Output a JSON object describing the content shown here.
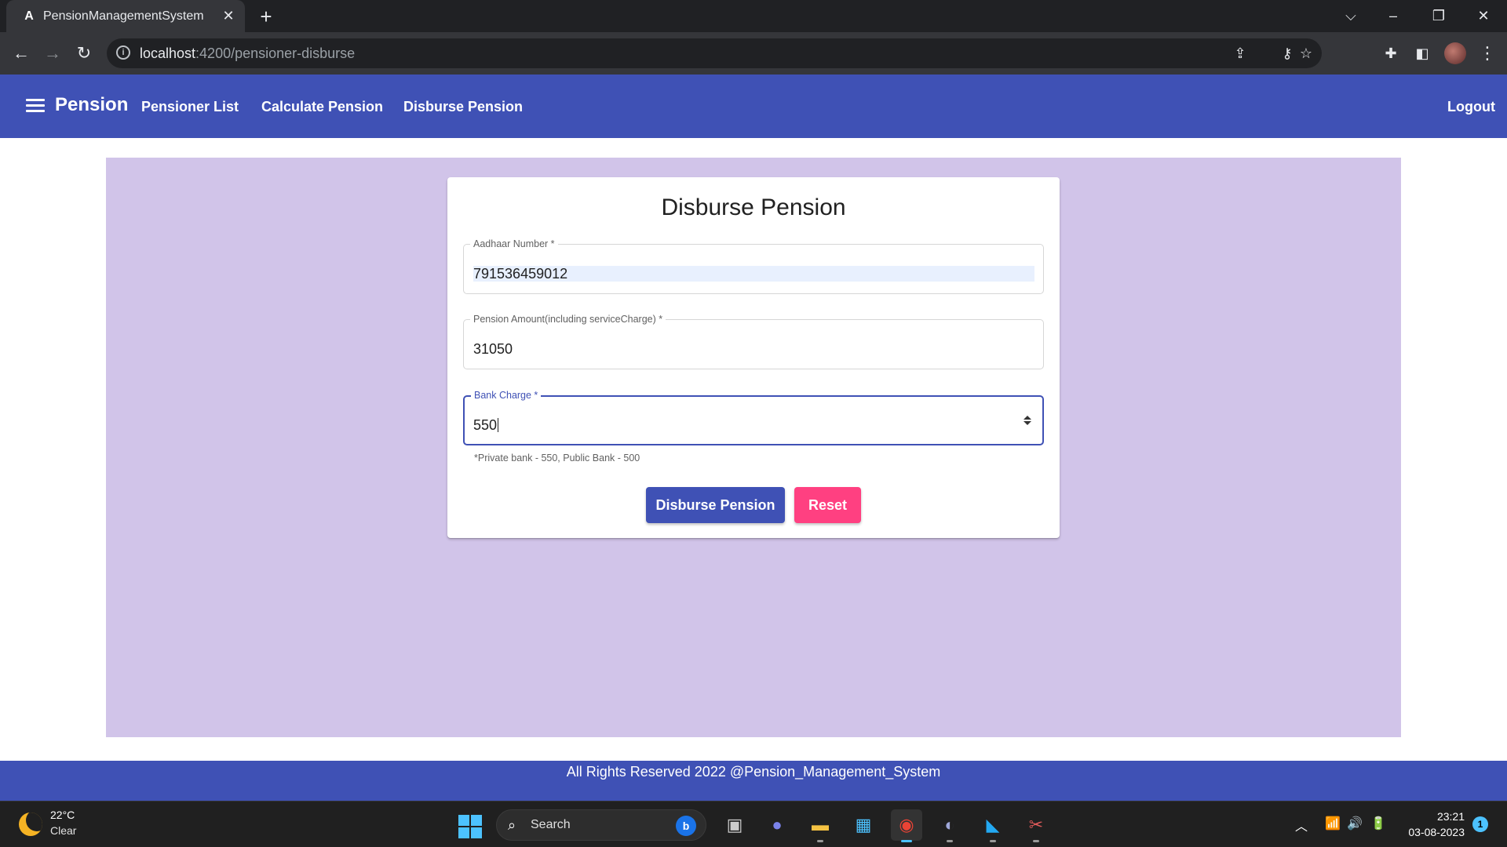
{
  "browser": {
    "tab_title": "PensionManagementSystem",
    "tab_favicon": "A",
    "url_host": "localhost",
    "url_path": ":4200/pensioner-disburse"
  },
  "header": {
    "brand": "Pension",
    "nav": [
      "Pensioner List",
      "Calculate Pension",
      "Disburse Pension"
    ],
    "logout": "Logout",
    "color": "#3f51b5"
  },
  "form": {
    "title": "Disburse Pension",
    "fields": [
      {
        "label": "Aadhaar Number *",
        "value": "791536459012"
      },
      {
        "label": "Pension Amount(including serviceCharge) *",
        "value": "31050"
      },
      {
        "label": "Bank Charge *",
        "value": "550"
      }
    ],
    "hint": "*Private bank - 550, Public Bank - 500",
    "submit_label": "Disburse Pension",
    "reset_label": "Reset",
    "accent": "#ff4081",
    "background": "#d1c4e9"
  },
  "footer": {
    "text": "All Rights Reserved 2022 @Pension_Management_System"
  },
  "taskbar": {
    "temperature": "22°C",
    "condition": "Clear",
    "search_label": "Search",
    "time": "23:21",
    "date": "03-08-2023",
    "notifications": "1"
  }
}
